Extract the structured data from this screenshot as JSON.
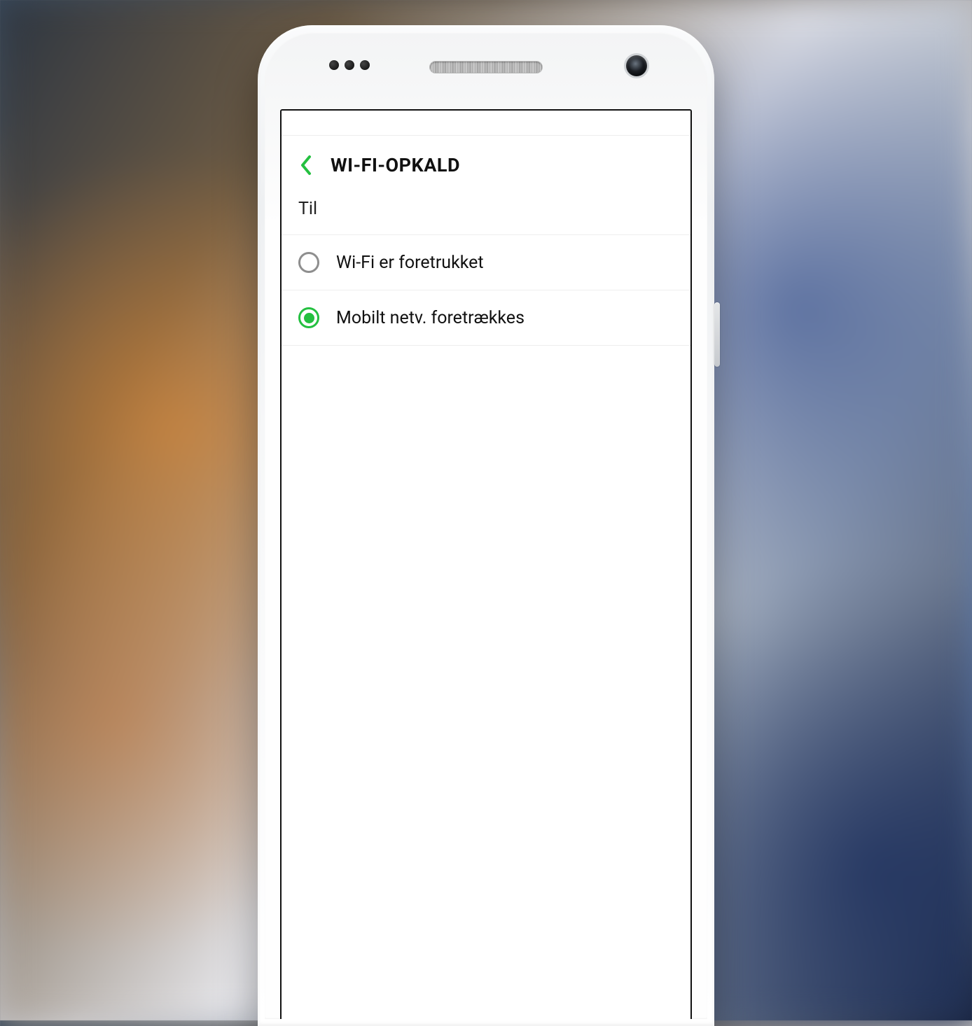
{
  "colors": {
    "accent": "#24c040"
  },
  "header": {
    "title": "WI-FI-OPKALD"
  },
  "status": {
    "label": "Til"
  },
  "options": [
    {
      "label": "Wi-Fi er foretrukket",
      "selected": false
    },
    {
      "label": "Mobilt netv. foretrækkes",
      "selected": true
    }
  ]
}
